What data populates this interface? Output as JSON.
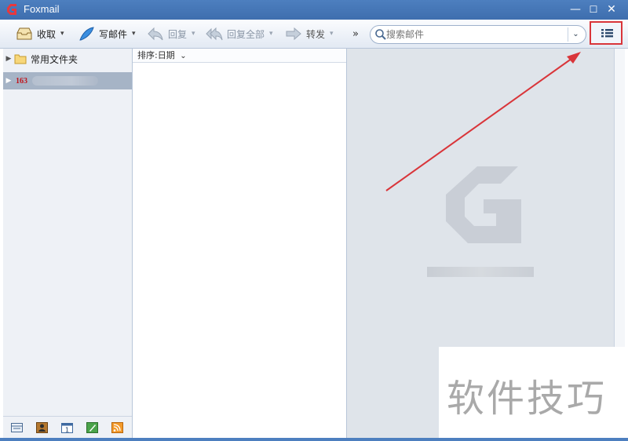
{
  "window": {
    "title": "Foxmail",
    "minimize": "—",
    "maximize": "☐",
    "close": "✕"
  },
  "toolbar": {
    "receive_label": "收取",
    "compose_label": "写邮件",
    "reply_label": "回复",
    "reply_all_label": "回复全部",
    "forward_label": "转发",
    "more_label": "»",
    "caret": "▾"
  },
  "search": {
    "placeholder": "搜索邮件",
    "dropdown": "⌄"
  },
  "sidebar": {
    "items": [
      {
        "label": "常用文件夹",
        "icon": "folder-icon"
      },
      {
        "label": "163",
        "icon": "163-account-icon"
      }
    ],
    "bottom_icons": [
      "mail-icon",
      "contacts-icon",
      "calendar-icon",
      "notes-icon",
      "rss-icon"
    ]
  },
  "message_list": {
    "sort_label": "排序:日期",
    "sort_caret": "⌄"
  },
  "watermark": {
    "text": "软件技巧"
  },
  "colors": {
    "titlebar": "#4d7fbf",
    "highlight": "#d9353a",
    "selection": "#a6b4c6"
  }
}
